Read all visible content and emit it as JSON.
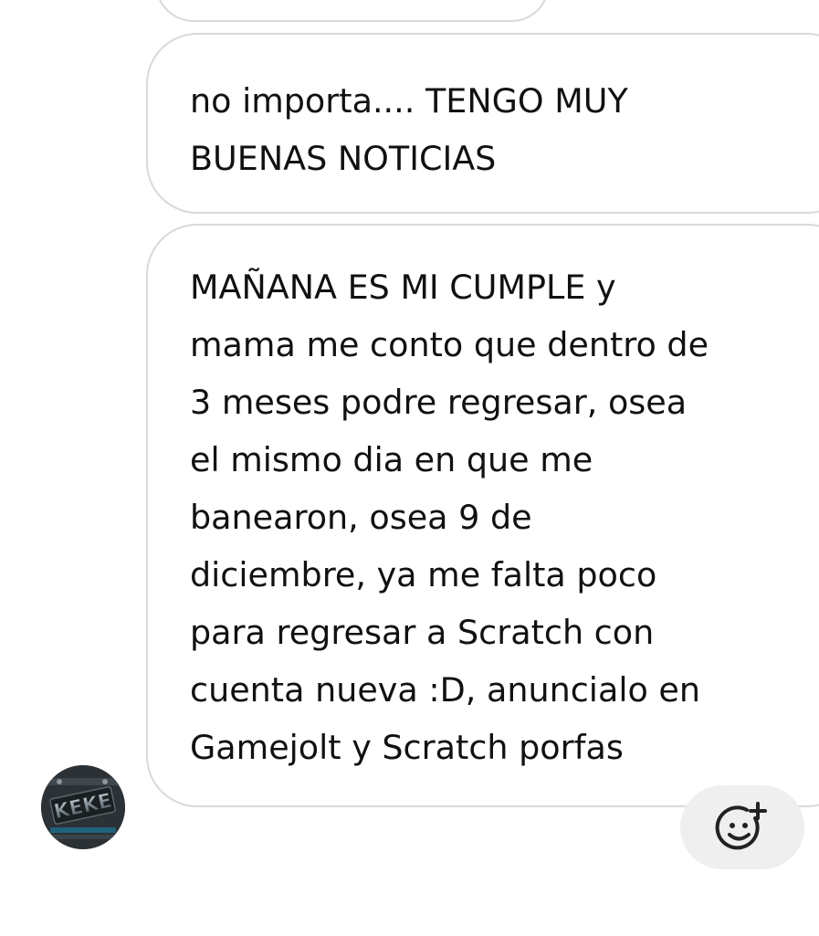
{
  "chat": {
    "messages": [
      {
        "lines": [
          "no importa.... TENGO MUY",
          "BUENAS NOTICIAS"
        ]
      },
      {
        "lines": [
          "MAÑANA ES MI CUMPLE y",
          "mama me conto que dentro de",
          "3 meses podre regresar, osea",
          "el mismo dia en que me",
          "banearon, osea 9 de",
          "diciembre, ya me falta poco",
          "para regresar a Scratch con",
          "cuenta nueva :D, anuncialo en",
          "Gamejolt y Scratch porfas"
        ]
      }
    ],
    "sender_avatar": {
      "logo_text": "KEKE",
      "icon": "avatar-image"
    },
    "reaction_button": {
      "icon": "add-reaction-smiley-icon"
    }
  },
  "colors": {
    "bubble_border": "#d9d9d9",
    "text": "#111111",
    "reaction_bg": "#efefef",
    "background": "#ffffff"
  }
}
